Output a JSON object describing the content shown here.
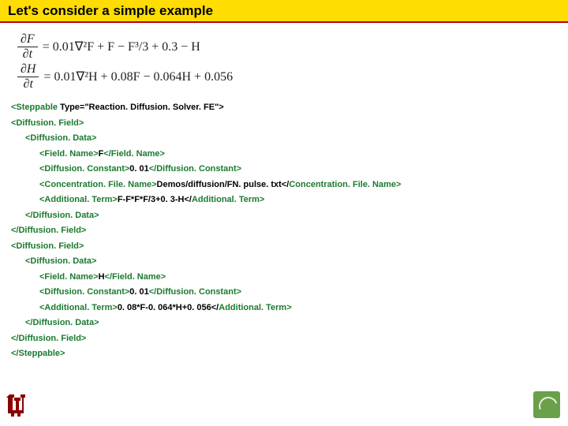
{
  "title": "Let's consider a simple example",
  "equations": {
    "eq1": {
      "num": "∂F",
      "den": "∂t",
      "rhs": "= 0.01∇²F + F − F³/3 + 0.3 − H"
    },
    "eq2": {
      "num": "∂H",
      "den": "∂t",
      "rhs": "= 0.01∇²H + 0.08F − 0.064H + 0.056"
    }
  },
  "code": {
    "l1_a": "<Steppable",
    "l1_b": " Type=\"Reaction. Diffusion. Solver. FE\">",
    "l2": "<Diffusion. Field>",
    "l3": "<Diffusion. Data>",
    "l4_a": "<Field. Name>",
    "l4_b": "F",
    "l4_c": "</Field. Name>",
    "l5_a": "<Diffusion. Constant>",
    "l5_b": "0. 01",
    "l5_c": "</Diffusion. Constant>",
    "l6_a": "<Concentration. File. Name>",
    "l6_b": "Demos/diffusion/FN. pulse. txt</",
    "l6_c": "Concentration. File. Name>",
    "l7_a": "<Additional. Term>",
    "l7_b": "F-F*F*F/3+0. 3-H</",
    "l7_c": "Additional. Term>",
    "l8": "</Diffusion. Data>",
    "l9": "</Diffusion. Field>",
    "l10": "<Diffusion. Field>",
    "l11": "<Diffusion. Data>",
    "l12_a": "<Field. Name>",
    "l12_b": "H",
    "l12_c": "</Field. Name>",
    "l13_a": "<Diffusion. Constant>",
    "l13_b": "0. 01",
    "l13_c": "</Diffusion. Constant>",
    "l14_a": "<Additional. Term>",
    "l14_b": "0. 08*F-0. 064*H+0. 056</",
    "l14_c": "Additional. Term>",
    "l15": "</Diffusion. Data>",
    "l16": "</Diffusion. Field>",
    "l17": "</Steppable>"
  }
}
